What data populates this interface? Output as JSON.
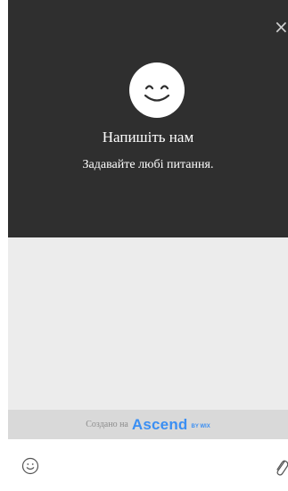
{
  "header": {
    "close_glyph": "×",
    "avatar_icon": "smiley-face-icon",
    "title": "Напишіть нам",
    "subtitle": "Задавайте любі питання."
  },
  "branding": {
    "prefix": "Создано на",
    "logo": "Ascend",
    "suffix": "BY WIX"
  },
  "composer": {
    "emoji_icon": "emoji-icon",
    "attach_icon": "paperclip-icon"
  },
  "colors": {
    "header_bg": "#2f2f2f",
    "messages_bg": "#ececec",
    "branding_bg": "#d9d9d9",
    "brand_accent": "#3b8ff3"
  }
}
